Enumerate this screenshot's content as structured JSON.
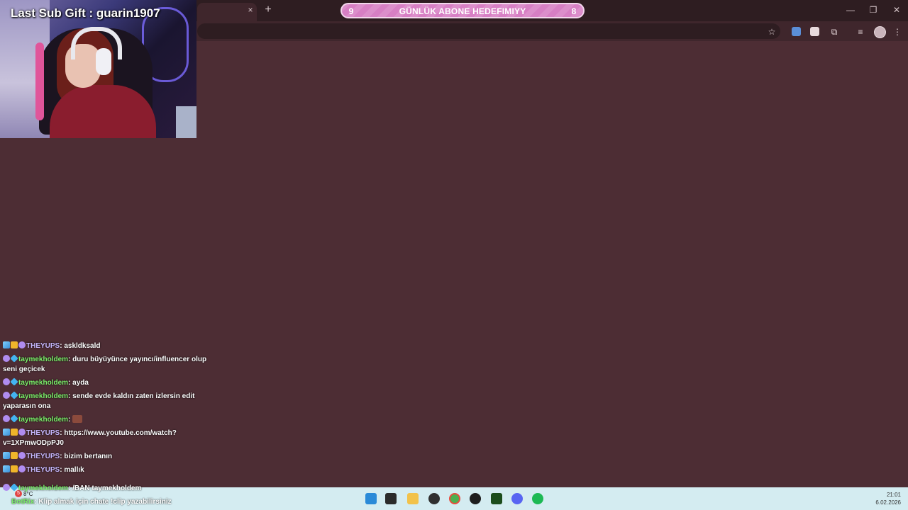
{
  "overlay": {
    "last_sub_gift": "Last Sub Gift : guarin1907"
  },
  "goal": {
    "current": "9",
    "title": "GÜNLÜK ABONE HEDEFIMIYY",
    "target": "8",
    "color": "#d77fc4"
  },
  "browser": {
    "tab_close": "×",
    "new_tab": "+",
    "window": {
      "minimize": "—",
      "restore": "❐",
      "close": "✕"
    },
    "toolbar_icons": [
      "bookmark-star-icon",
      "translate-icon",
      "extension-c-icon",
      "puzzle-icon",
      "media-queue-icon",
      "profile-avatar-icon",
      "more-menu-icon"
    ]
  },
  "chat": {
    "messages": [
      {
        "user": "THEYUPS",
        "text": ": askldksald"
      },
      {
        "user": "taymekholdem",
        "text": ": duru büyüyünce yayıncı/influencer olup seni geçicek"
      },
      {
        "user": "taymekholdem",
        "text": ": ayda"
      },
      {
        "user": "taymekholdem",
        "text": ": sende evde kaldın zaten izlersin edit yaparasın ona"
      },
      {
        "user": "taymekholdem",
        "text": ":"
      },
      {
        "user": "THEYUPS",
        "text": ": https://www.youtube.com/watch?v=1XPmwODpPJ0"
      },
      {
        "user": "THEYUPS",
        "text": ": bizim bertanın"
      },
      {
        "user": "THEYUPS",
        "text": ": mallık"
      }
    ],
    "partial_line": {
      "user": "taymekholdem",
      "text": ": /BAN taymekholdem"
    },
    "notice": {
      "bot": "BotRix",
      "text": ": Klip almak için chate !clip yazabilirsiniz"
    }
  },
  "taskbar": {
    "weather_badge": "5",
    "temperature": "8°C",
    "time": "21:01",
    "date": "6.02.2026",
    "apps": [
      "start-icon",
      "file-manager-icon",
      "folder-icon",
      "obs-icon",
      "chrome-icon",
      "g-app-icon",
      "terminal-icon",
      "discord-icon",
      "spotify-icon"
    ]
  }
}
